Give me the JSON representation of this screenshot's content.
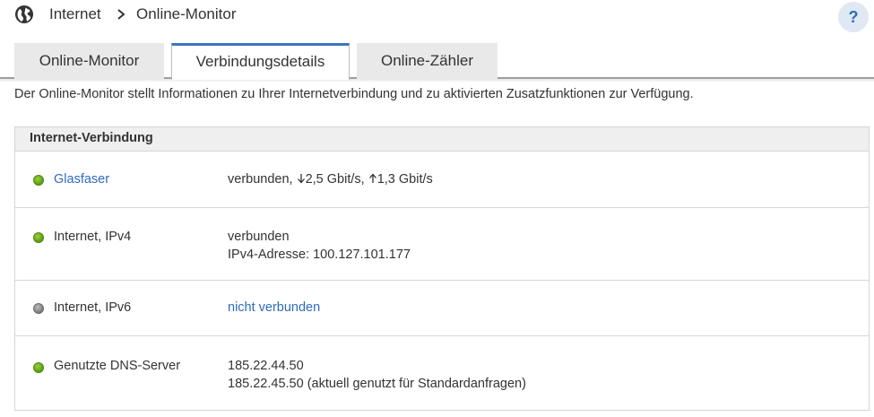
{
  "breadcrumb": {
    "home_icon": "globe-icon",
    "section": "Internet",
    "separator_icon": "chevron-right-icon",
    "page": "Online-Monitor"
  },
  "help": {
    "label": "?"
  },
  "tabs": [
    {
      "label": "Online-Monitor",
      "active": false
    },
    {
      "label": "Verbindungsdetails",
      "active": true
    },
    {
      "label": "Online-Zähler",
      "active": false
    }
  ],
  "intro_text": "Der Online-Monitor stellt Informationen zu Ihrer Internetverbindung und zu aktivierten Zusatzfunktionen zur Verfügung.",
  "panel": {
    "title": "Internet-Verbindung",
    "rows": [
      {
        "status": "green",
        "label": "Glasfaser",
        "value_prefix": "verbunden,",
        "down_icon": "arrow-down-icon",
        "down": "2,5 Gbit/s,",
        "up_icon": "arrow-up-icon",
        "up": "1,3 Gbit/s"
      },
      {
        "status": "green",
        "label": "Internet, IPv4",
        "line1": "verbunden",
        "line2": "IPv4-Adresse: 100.127.101.177"
      },
      {
        "status": "gray",
        "label": "Internet, IPv6",
        "value": "nicht verbunden"
      },
      {
        "status": "green",
        "label": "Genutzte DNS-Server",
        "line1": "185.22.44.50",
        "line2": "185.22.45.50 (aktuell genutzt für Standardanfragen)"
      }
    ]
  },
  "colors": {
    "link": "#2d6bbf",
    "active_tab_accent": "#3a75c4",
    "status_green": "#5b9a12",
    "status_gray": "#7a7a7a"
  }
}
